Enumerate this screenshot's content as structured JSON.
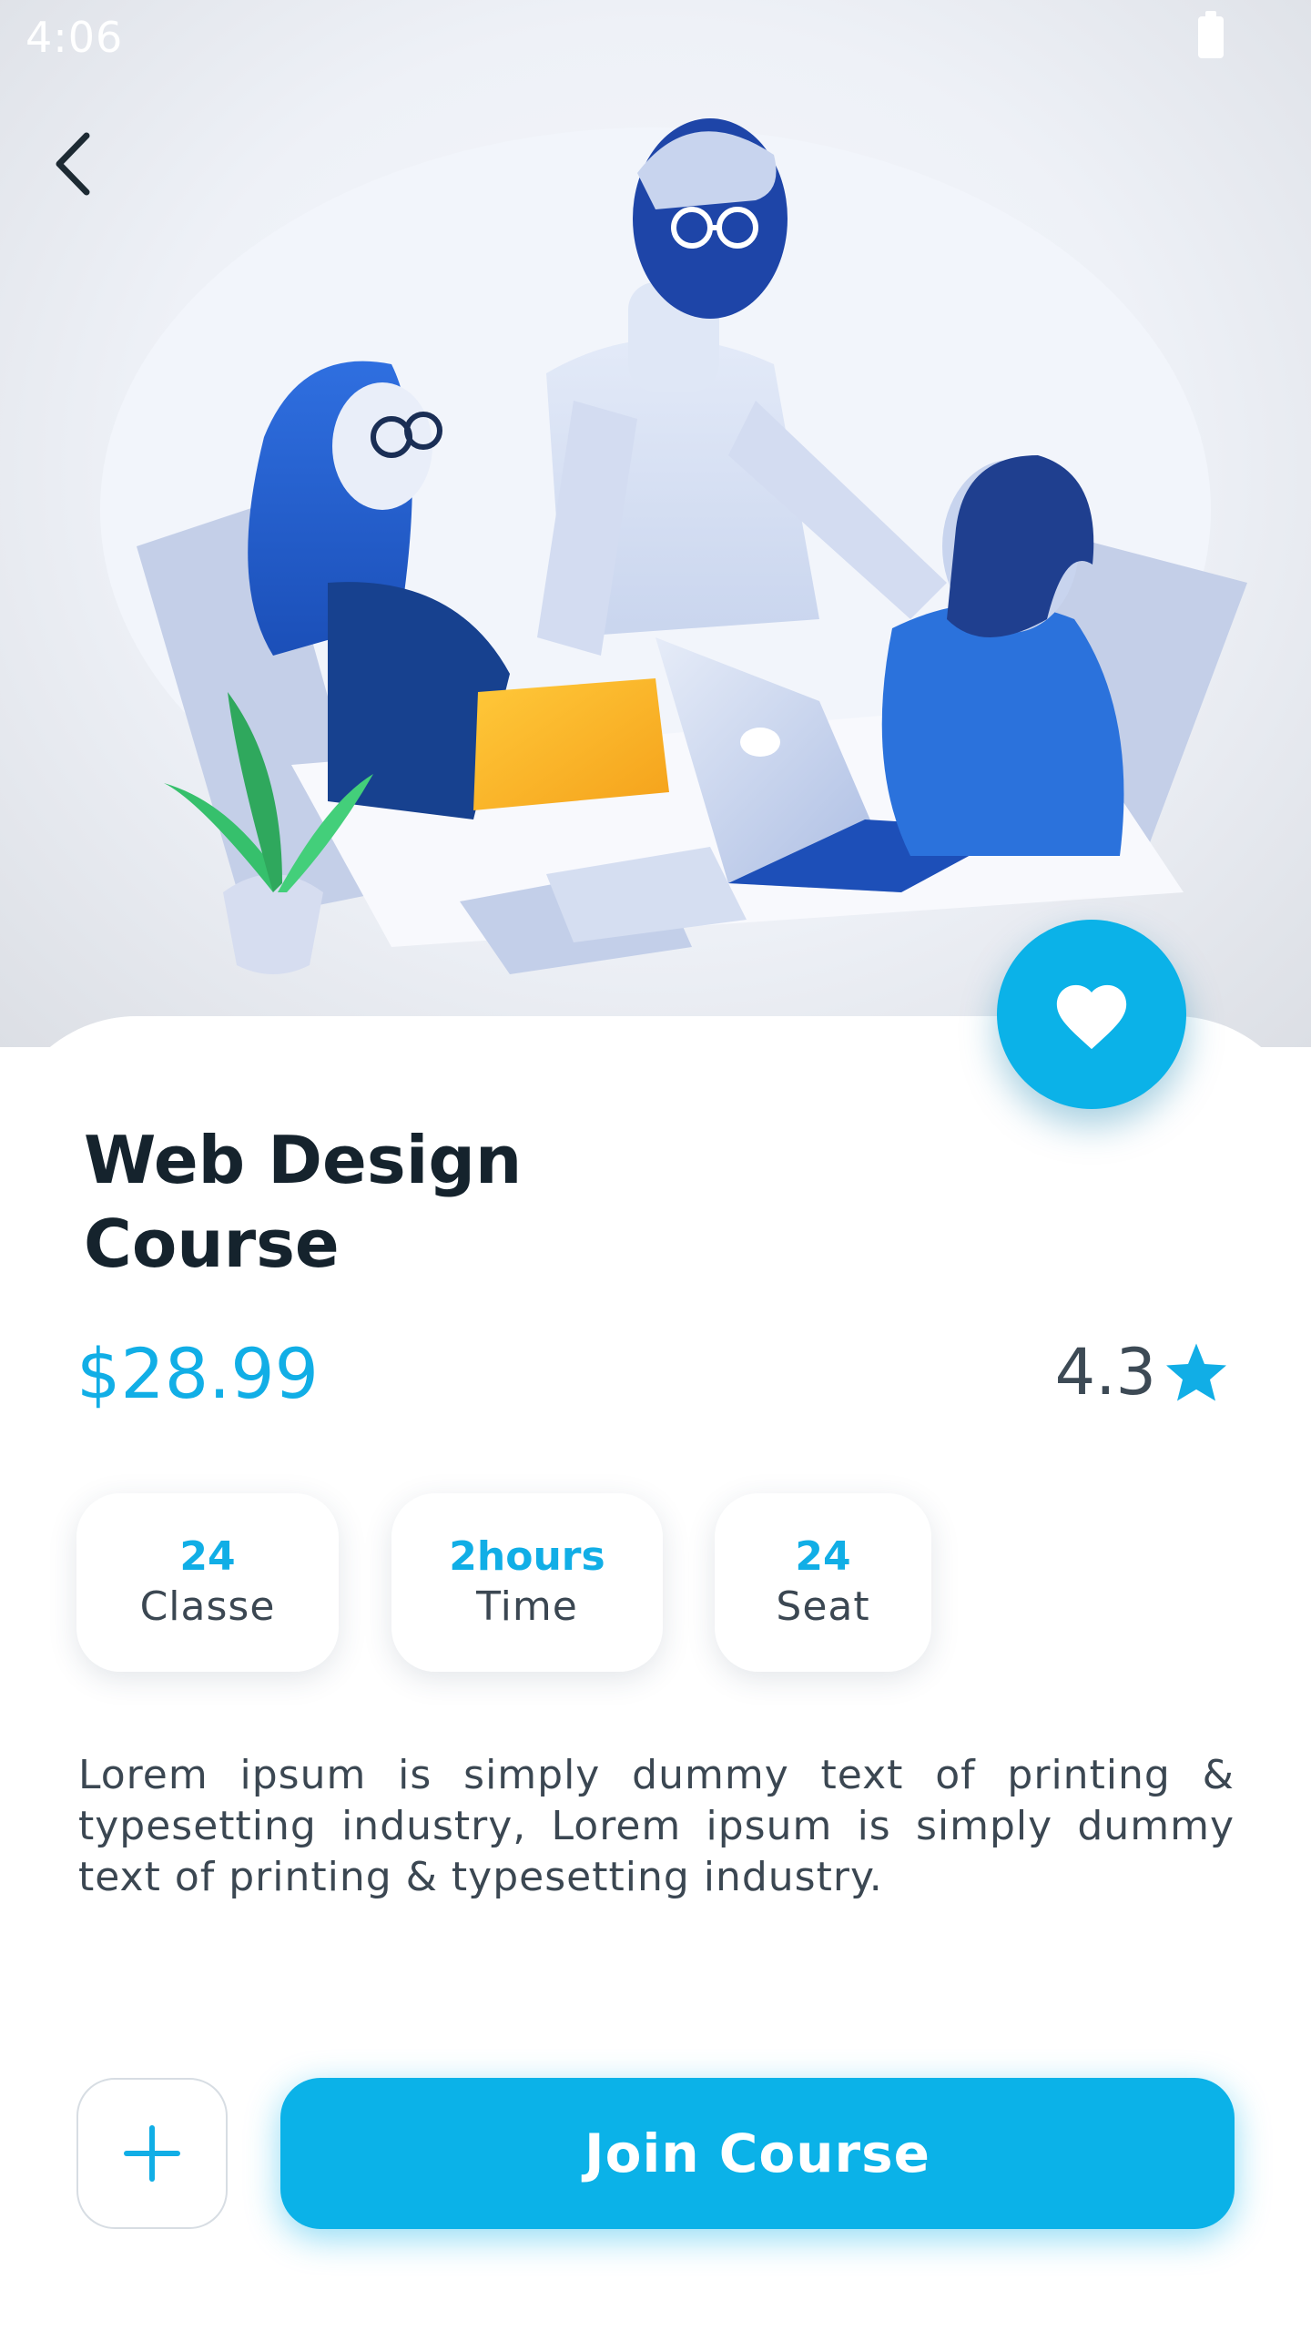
{
  "status_bar": {
    "time": "4:06"
  },
  "header": {
    "back_icon": "chevron-left-icon"
  },
  "hero": {
    "illustration": "team-meeting-illustration"
  },
  "favorite": {
    "icon": "heart-icon"
  },
  "course": {
    "title_line1": "Web Design",
    "title_line2": "Course",
    "price": "$28.99",
    "rating": "4.3",
    "rating_icon": "star-icon"
  },
  "stats": [
    {
      "value": "24",
      "label": "Classe"
    },
    {
      "value": "2hours",
      "label": "Time"
    },
    {
      "value": "24",
      "label": "Seat"
    }
  ],
  "description": "Lorem ipsum is simply dummy text of printing & typesetting industry, Lorem ipsum is simply dummy text of printing & typesetting industry.",
  "actions": {
    "add_icon": "plus-icon",
    "join_label": "Join Course"
  },
  "colors": {
    "accent": "#0bb2e8",
    "title": "#15232d",
    "body_text": "#3b4752"
  }
}
